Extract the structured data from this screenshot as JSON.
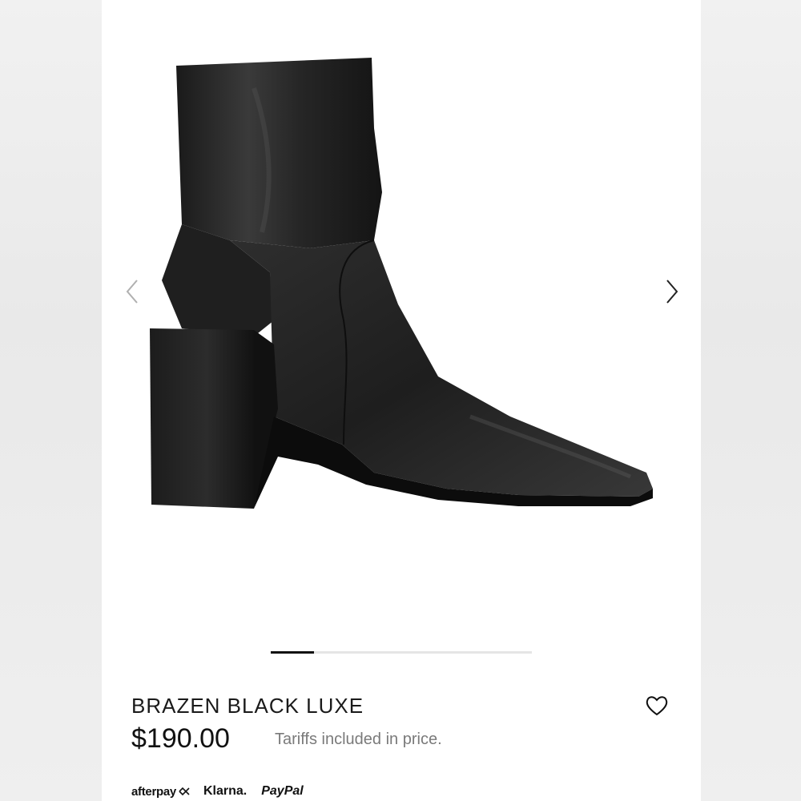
{
  "product": {
    "name": "BRAZEN BLACK LUXE",
    "price": "$190.00",
    "tariff_note": "Tariffs included in price."
  },
  "gallery": {
    "image_icon": "black-ankle-boot-image",
    "prev_icon": "chevron-left-icon",
    "next_icon": "chevron-right-icon",
    "progress_fraction": 0.167
  },
  "wishlist": {
    "icon": "heart-outline-icon"
  },
  "payments": {
    "afterpay": "afterpay",
    "klarna": "Klarna.",
    "paypal": "PayPal"
  },
  "colors": {
    "accent": "#111111",
    "muted_text": "#7a7a7a",
    "progress_track": "#e5e5e5"
  }
}
